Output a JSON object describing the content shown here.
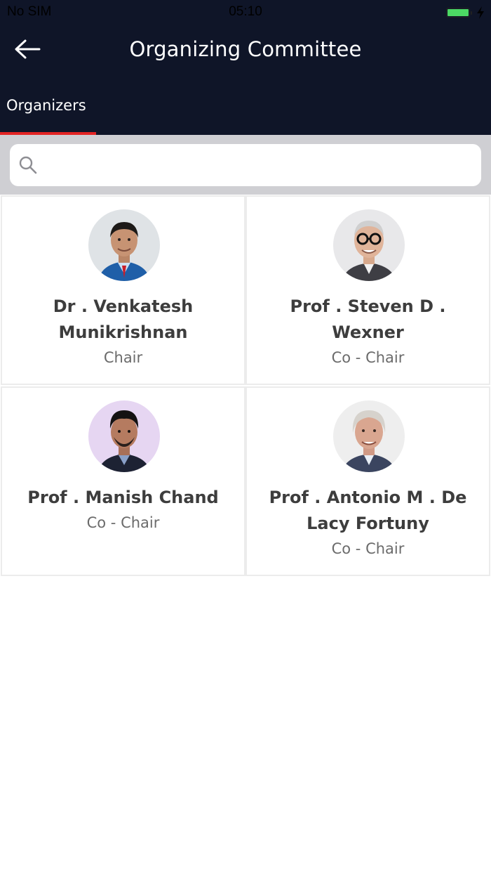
{
  "status_bar": {
    "carrier": "No SIM",
    "time": "05:10"
  },
  "header": {
    "title": "Organizing Committee",
    "back_icon": "arrow-left-icon"
  },
  "tabs": [
    {
      "label": "Organizers",
      "active": true
    }
  ],
  "search": {
    "placeholder": "",
    "value": ""
  },
  "colors": {
    "header_bg": "#0f1528",
    "tab_indicator": "#e32424",
    "battery": "#4cd964",
    "search_bar_bg": "#cfcfd3"
  },
  "organizers": [
    {
      "name": "Dr . Venkatesh Munikrishnan",
      "role": "Chair"
    },
    {
      "name": "Prof . Steven D . Wexner",
      "role": "Co - Chair"
    },
    {
      "name": "Prof . Manish Chand",
      "role": "Co - Chair"
    },
    {
      "name": "Prof . Antonio M . De Lacy Fortuny",
      "role": "Co - Chair"
    }
  ]
}
